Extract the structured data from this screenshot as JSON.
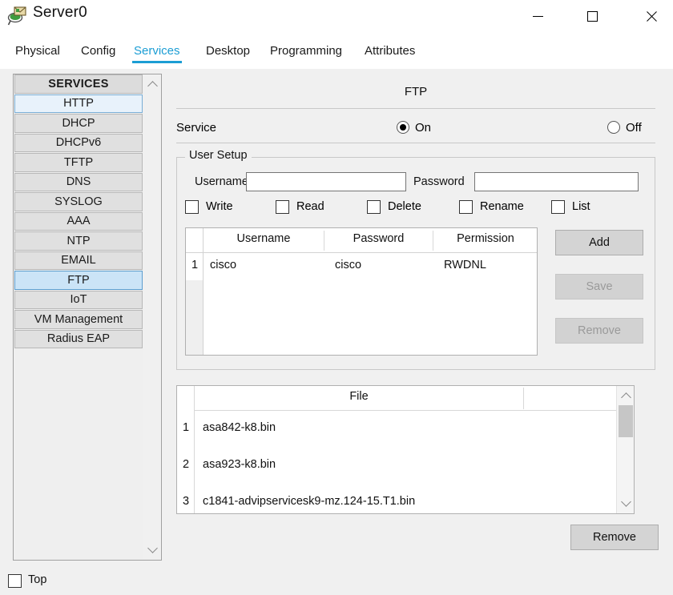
{
  "window": {
    "title": "Server0",
    "icon": "server-mail-icon",
    "minimize_label": "Minimize",
    "maximize_label": "Maximize",
    "close_label": "Close"
  },
  "tabs": [
    {
      "label": "Physical",
      "active": false
    },
    {
      "label": "Config",
      "active": false
    },
    {
      "label": "Services",
      "active": true
    },
    {
      "label": "Desktop",
      "active": false
    },
    {
      "label": "Programming",
      "active": false
    },
    {
      "label": "Attributes",
      "active": false
    }
  ],
  "sidebar": {
    "header": "SERVICES",
    "items": [
      {
        "label": "HTTP",
        "state": "hover"
      },
      {
        "label": "DHCP",
        "state": "normal"
      },
      {
        "label": "DHCPv6",
        "state": "normal"
      },
      {
        "label": "TFTP",
        "state": "normal"
      },
      {
        "label": "DNS",
        "state": "normal"
      },
      {
        "label": "SYSLOG",
        "state": "normal"
      },
      {
        "label": "AAA",
        "state": "normal"
      },
      {
        "label": "NTP",
        "state": "normal"
      },
      {
        "label": "EMAIL",
        "state": "normal"
      },
      {
        "label": "FTP",
        "state": "selected"
      },
      {
        "label": "IoT",
        "state": "normal"
      },
      {
        "label": "VM Management",
        "state": "normal"
      },
      {
        "label": "Radius EAP",
        "state": "normal"
      }
    ],
    "scroll_up_icon": "chevron-up-icon",
    "scroll_down_icon": "chevron-down-icon"
  },
  "panel": {
    "title": "FTP",
    "service": {
      "label": "Service",
      "on_label": "On",
      "off_label": "Off",
      "selected": "On"
    },
    "user_setup": {
      "legend": "User Setup",
      "username_label": "Username",
      "username_value": "",
      "username_placeholder": "",
      "password_label": "Password",
      "password_value": "",
      "password_placeholder": "",
      "permissions": [
        {
          "label": "Write",
          "checked": false
        },
        {
          "label": "Read",
          "checked": false
        },
        {
          "label": "Delete",
          "checked": false
        },
        {
          "label": "Rename",
          "checked": false
        },
        {
          "label": "List",
          "checked": false
        }
      ],
      "table": {
        "columns": [
          "Username",
          "Password",
          "Permission"
        ],
        "rows": [
          {
            "num": "1",
            "username": "cisco",
            "password": "cisco",
            "permission": "RWDNL"
          }
        ]
      },
      "buttons": {
        "add": "Add",
        "save": "Save",
        "remove": "Remove"
      }
    },
    "files": {
      "column": "File",
      "rows": [
        {
          "num": "1",
          "name": "asa842-k8.bin"
        },
        {
          "num": "2",
          "name": "asa923-k8.bin"
        },
        {
          "num": "3",
          "name": "c1841-advipservicesk9-mz.124-15.T1.bin"
        }
      ],
      "remove_label": "Remove",
      "scroll_up_icon": "chevron-up-icon",
      "scroll_down_icon": "chevron-down-icon"
    }
  },
  "bottom": {
    "top_label": "Top",
    "top_checked": false
  },
  "colors": {
    "accent": "#1b9dd4",
    "selected_item": "#cbe4f7",
    "hover_item": "#e8f2fb",
    "panel_bg": "#f0f0f0",
    "button_bg": "#d4d4d4"
  }
}
